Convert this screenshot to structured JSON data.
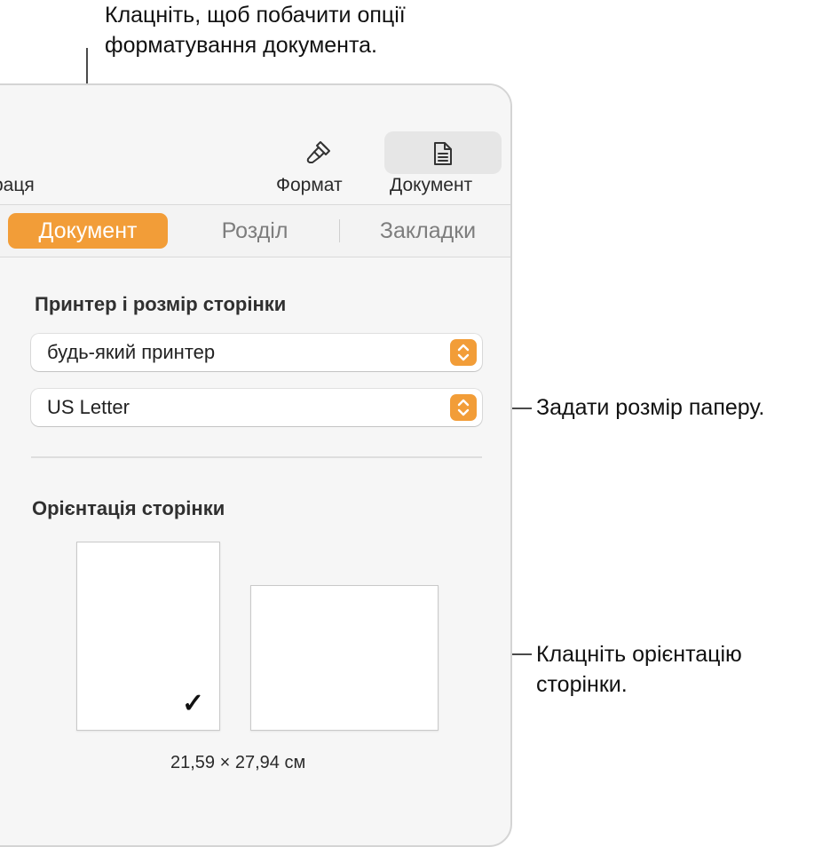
{
  "callouts": {
    "top": "Клацніть, щоб побачити опції\nформатування документа.",
    "paper_size": "Задати розмір паперу.",
    "orientation": "Клацніть орієнтацію\nсторінки."
  },
  "toolbar": {
    "partial_label": "раця",
    "format_label": "Формат",
    "document_label": "Документ"
  },
  "tabs": [
    {
      "label": "Документ",
      "active": true
    },
    {
      "label": "Розділ",
      "active": false
    },
    {
      "label": "Закладки",
      "active": false
    }
  ],
  "printer_section": {
    "title": "Принтер і розмір сторінки",
    "printer_value": "будь-який принтер",
    "paper_value": "US Letter"
  },
  "orientation_section": {
    "title": "Орієнтація сторінки",
    "portrait_selected": true,
    "dimensions": "21,59 × 27,94 см"
  },
  "colors": {
    "accent": "#f29d38",
    "panel_bg": "#f6f6f6"
  }
}
